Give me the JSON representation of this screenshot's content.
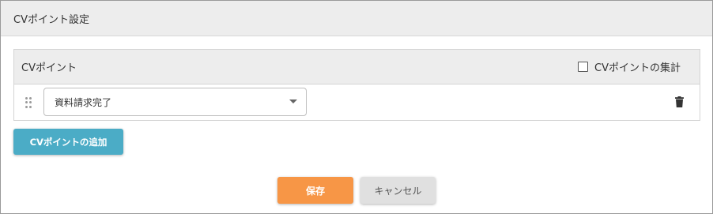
{
  "dialog": {
    "title": "CVポイント設定"
  },
  "panel": {
    "header_label": "CVポイント",
    "aggregate_label": "CVポイントの集計",
    "aggregate_checked": false,
    "rows": [
      {
        "selected_value": "資料請求完了"
      }
    ]
  },
  "buttons": {
    "add_label": "CVポイントの追加",
    "save_label": "保存",
    "cancel_label": "キャンセル"
  },
  "icons": {
    "drag": "drag-handle-icon",
    "dropdown": "caret-down-icon",
    "delete": "trash-icon"
  },
  "colors": {
    "add_button": "#4bacc6",
    "save_button": "#f79646",
    "cancel_button": "#e0e0e0",
    "header_bg": "#ededed"
  }
}
